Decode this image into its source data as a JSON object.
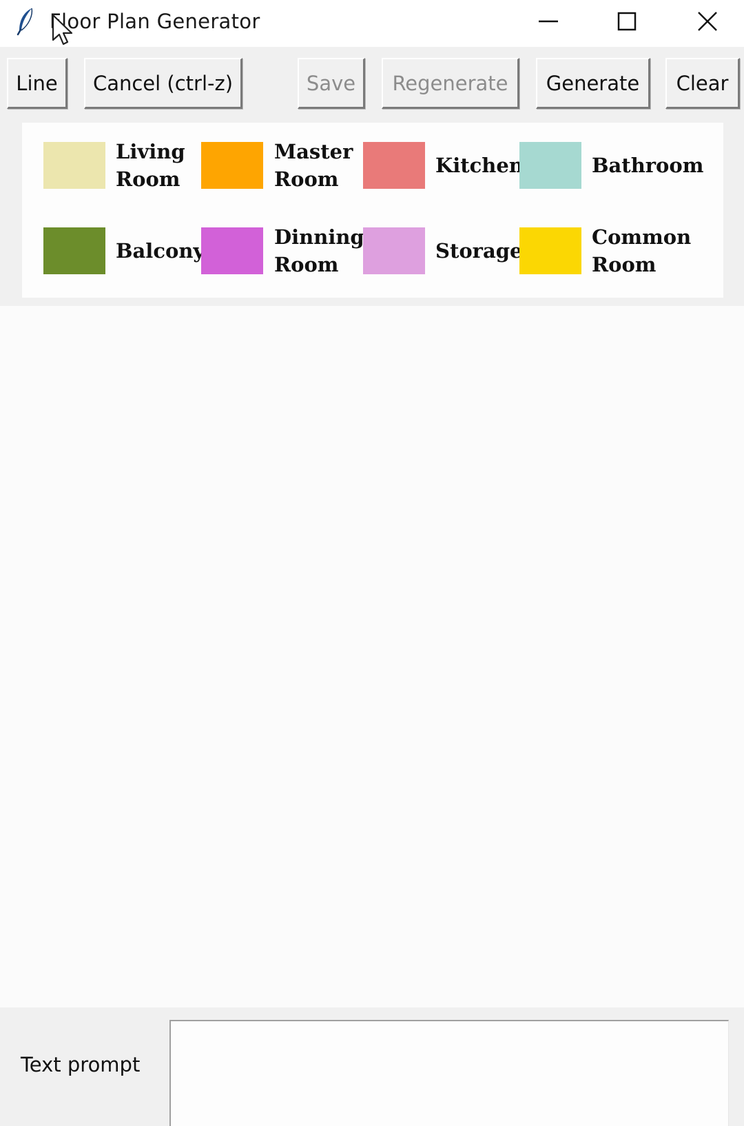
{
  "window": {
    "title": "Floor Plan Generator",
    "icon": "feather-icon",
    "controls": [
      "minimize-icon",
      "maximize-icon",
      "close-icon"
    ]
  },
  "toolbar": {
    "line_label": "Line",
    "cancel_label": "Cancel (ctrl-z)",
    "save_label": "Save",
    "regenerate_label": "Regenerate",
    "generate_label": "Generate",
    "clear_label": "Clear",
    "disabled": [
      "Save",
      "Regenerate"
    ]
  },
  "legend": {
    "items": [
      {
        "lines": [
          "Living",
          "Room"
        ],
        "color": "#ece6ae"
      },
      {
        "lines": [
          "Master",
          "Room"
        ],
        "color": "#fea501"
      },
      {
        "lines": [
          "Kitchen"
        ],
        "color": "#e97a79"
      },
      {
        "lines": [
          "Bathroom"
        ],
        "color": "#a6d9d1"
      },
      {
        "lines": [
          "Balcony"
        ],
        "color": "#6c8d2b"
      },
      {
        "lines": [
          "Dinning",
          "Room"
        ],
        "color": "#d261d8"
      },
      {
        "lines": [
          "Storage"
        ],
        "color": "#dea0df"
      },
      {
        "lines": [
          "Common",
          "Room"
        ],
        "color": "#fbd703"
      }
    ]
  },
  "prompt": {
    "label": "Text prompt",
    "value": ""
  }
}
